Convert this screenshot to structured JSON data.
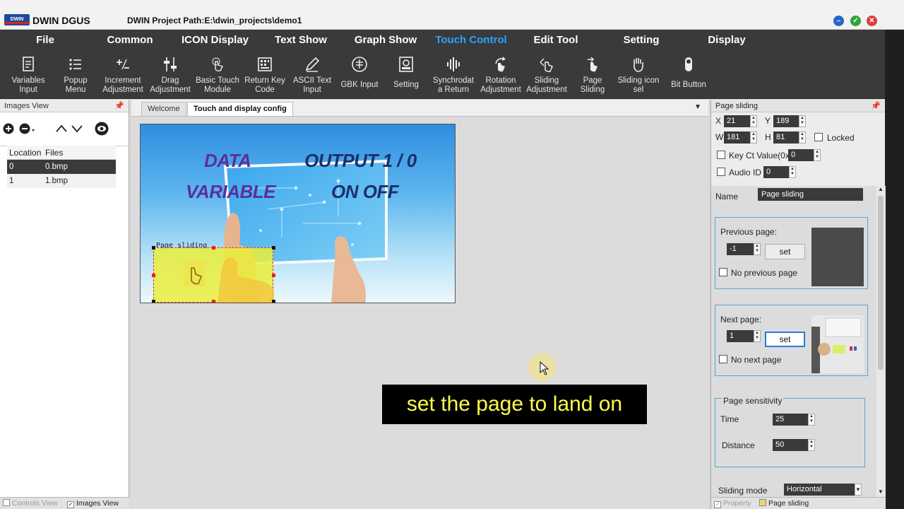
{
  "titlebar": {
    "logo_text": "DWIN",
    "app_name": "DWIN DGUS",
    "project_path": "DWIN Project Path:E:\\dwin_projects\\demo1"
  },
  "menu": {
    "items": [
      "File",
      "Common",
      "ICON Display",
      "Text Show",
      "Graph Show",
      "Touch Control",
      "Edit Tool",
      "Setting",
      "Display"
    ],
    "active": "Touch Control",
    "active_color": "#2aa3ff"
  },
  "toolbar": {
    "tools": [
      {
        "label": "Variables\nInput",
        "icon": "doc-icon"
      },
      {
        "label": "Popup\nMenu",
        "icon": "list-icon"
      },
      {
        "label": "Increment\nAdjustment",
        "icon": "plus-minus-icon"
      },
      {
        "label": "Drag\nAdjustment",
        "icon": "sliders-icon"
      },
      {
        "label": "Basic Touch\nModule",
        "icon": "touch-icon"
      },
      {
        "label": "Return Key\nCode",
        "icon": "keyboard-icon"
      },
      {
        "label": "ASCII Text\nInput",
        "icon": "pen-icon"
      },
      {
        "label": "GBK Input",
        "icon": "gbk-icon"
      },
      {
        "label": "Setting",
        "icon": "setting-icon"
      },
      {
        "label": "Synchrodat\na Return",
        "icon": "wave-icon"
      },
      {
        "label": "Rotation\nAdjustment",
        "icon": "rotate-icon"
      },
      {
        "label": "Sliding\nAdjustment",
        "icon": "slide-icon"
      },
      {
        "label": "Page\nSliding",
        "icon": "page-swipe-icon"
      },
      {
        "label": "Sliding icon\nsel",
        "icon": "hand-icon"
      },
      {
        "label": "Bit Button",
        "icon": "bit-button-icon"
      }
    ]
  },
  "images_view": {
    "title": "Images View",
    "columns": [
      "Location",
      "Files"
    ],
    "rows": [
      {
        "location": "0",
        "file": "0.bmp"
      },
      {
        "location": "1",
        "file": "1.bmp"
      }
    ],
    "bottom_tabs": [
      "Controls View",
      "Images View"
    ]
  },
  "document": {
    "tabs": [
      "Welcome",
      "Touch and display config"
    ],
    "active_tab": "Touch and display config",
    "canvas_texts": [
      "DATA",
      "VARIABLE",
      "OUTPUT 1 / 0",
      "ON OFF"
    ],
    "control_label": "Page sliding"
  },
  "subtitle": "set the page to land on",
  "properties": {
    "title": "Page sliding",
    "x_label": "X",
    "x": "21",
    "y_label": "Y",
    "y": "189",
    "w_label": "W",
    "w": "181",
    "h_label": "H",
    "h": "81",
    "locked_label": "Locked",
    "key_ct_label": "Key Ct Value(0x)",
    "key_ct": "0",
    "audio_label": "Audio ID",
    "audio": "0",
    "name_label": "Name",
    "name": "Page sliding",
    "previous": {
      "title": "Previous page:",
      "value": "-1",
      "set_label": "set",
      "none_label": "No previous page"
    },
    "next": {
      "title": "Next page:",
      "value": "1",
      "set_label": "set",
      "none_label": "No next page"
    },
    "sensitivity": {
      "title": "Page sensitivity",
      "time_label": "Time",
      "time": "25",
      "distance_label": "Distance",
      "distance": "50"
    },
    "sliding_mode_label": "Sliding mode",
    "sliding_mode": "Horizontal",
    "bottom_tabs": [
      "Property",
      "Page sliding"
    ]
  }
}
